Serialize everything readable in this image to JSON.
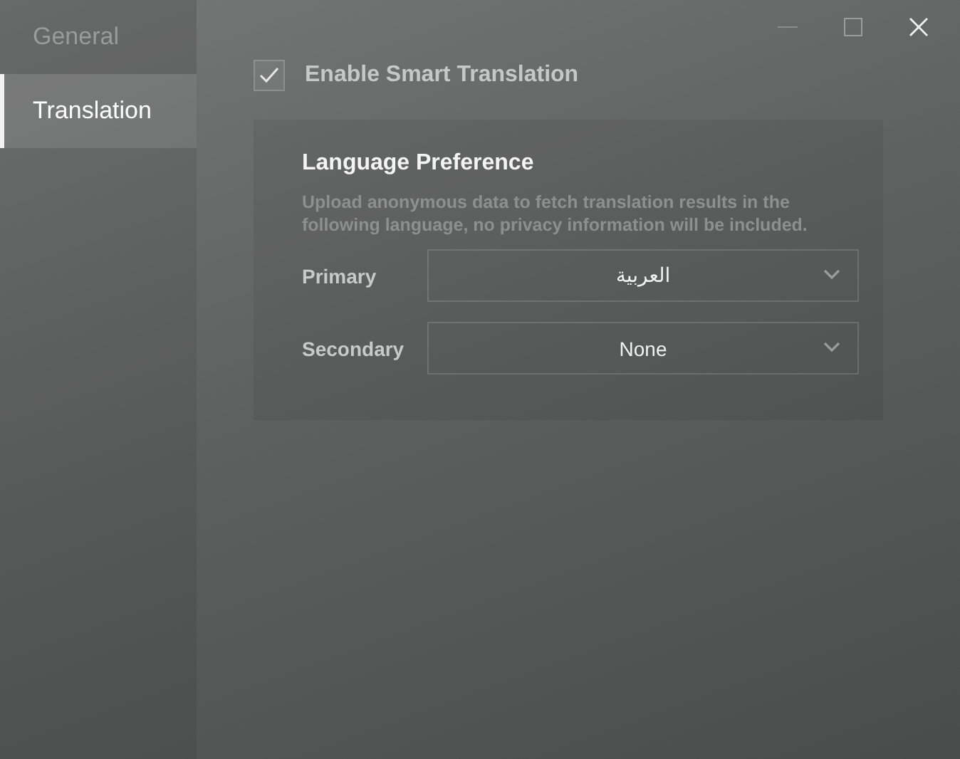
{
  "sidebar": {
    "items": [
      {
        "label": "General",
        "selected": false
      },
      {
        "label": "Translation",
        "selected": true
      }
    ]
  },
  "smart_translation": {
    "label": "Enable Smart Translation",
    "checked": true
  },
  "language_preference": {
    "title": "Language Preference",
    "description": "Upload anonymous data to fetch translation results in the following language, no privacy information will be included.",
    "fields": [
      {
        "label": "Primary",
        "value": "العربية"
      },
      {
        "label": "Secondary",
        "value": "None"
      }
    ]
  }
}
